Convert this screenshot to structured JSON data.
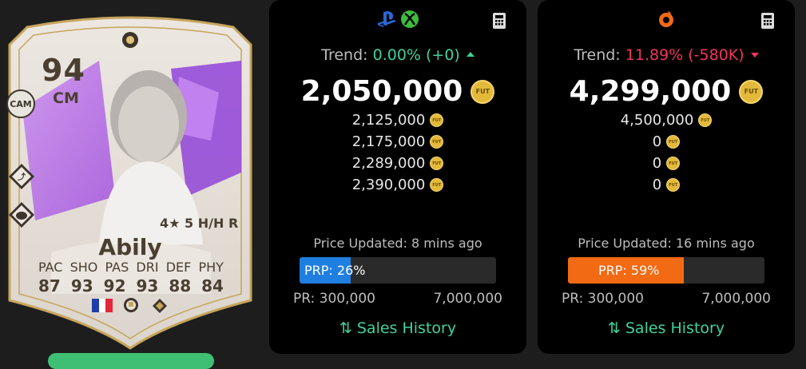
{
  "card": {
    "rating": "94",
    "position": "CM",
    "alt_position": "CAM",
    "skills_line": "4★ 5 H/H R",
    "name": "Abily",
    "stat_labels": [
      "PAC",
      "SHO",
      "PAS",
      "DRI",
      "DEF",
      "PHY"
    ],
    "stat_values": [
      "87",
      "93",
      "92",
      "93",
      "88",
      "84"
    ],
    "nation_flag": "france",
    "icons": [
      "crest-icon",
      "playstyle-pass-icon",
      "playstyle-raccoon-icon",
      "league-badge-icon",
      "club-badge-icon"
    ]
  },
  "panels": [
    {
      "platform_icons": [
        "playstation-icon",
        "xbox-icon"
      ],
      "trend_label": "Trend:",
      "trend_value": "0.00% (+0)",
      "trend_direction": "up",
      "main_price": "2,050,000",
      "prices": [
        "2,125,000",
        "2,175,000",
        "2,289,000",
        "2,390,000"
      ],
      "updated": "Price Updated: 8 mins ago",
      "prp_label": "PRP: 26%",
      "prp_percent": 26,
      "prp_color": "#1f7fe0",
      "pr_min": "PR: 300,000",
      "pr_max": "7,000,000",
      "sales_history": "Sales History"
    },
    {
      "platform_icons": [
        "origin-icon"
      ],
      "trend_label": "Trend:",
      "trend_value": "11.89% (-580K)",
      "trend_direction": "down",
      "main_price": "4,299,000",
      "prices": [
        "4,500,000",
        "0",
        "0",
        "0"
      ],
      "updated": "Price Updated: 16 mins ago",
      "prp_label": "PRP: 59%",
      "prp_percent": 59,
      "prp_color": "#f26a14",
      "pr_min": "PR: 300,000",
      "pr_max": "7,000,000",
      "sales_history": "Sales History"
    }
  ],
  "coin_label": "FUT",
  "colors": {
    "up": "#3fd39a",
    "down": "#f0365a",
    "gold": "#e2b93b"
  }
}
